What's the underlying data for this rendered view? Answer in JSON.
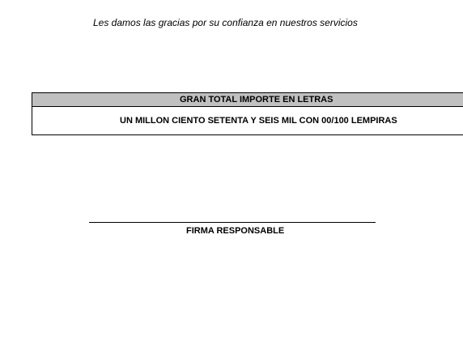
{
  "document": {
    "thanks_message": "Les damos las gracias por su confianza en nuestros servicios",
    "total_section": {
      "header": "GRAN TOTAL IMPORTE EN LETRAS",
      "amount_in_words": "UN MILLON CIENTO SETENTA Y SEIS MIL CON 00/100 LEMPIRAS"
    },
    "signature": {
      "label": "FIRMA RESPONSABLE"
    }
  },
  "colors": {
    "header_background": "#c0c0c0",
    "border": "#000000",
    "text": "#000000"
  }
}
